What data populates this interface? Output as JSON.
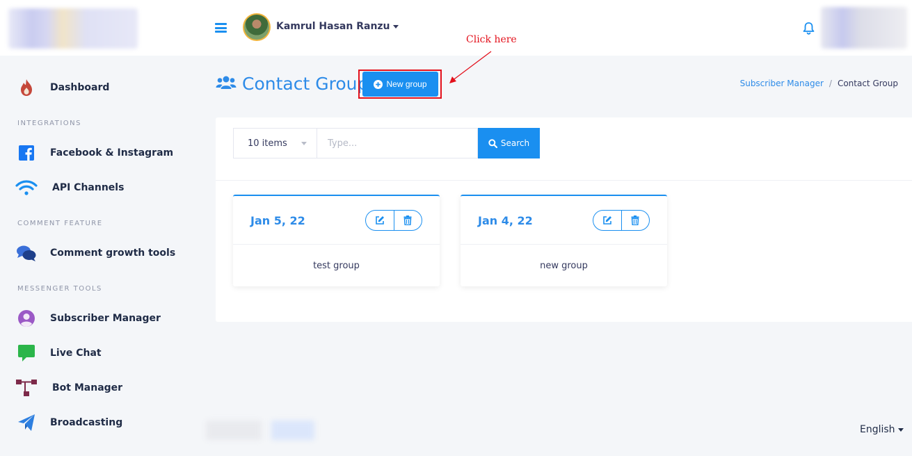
{
  "header": {
    "user_name": "Kamrul Hasan Ranzu"
  },
  "sidebar": {
    "sections": {
      "integrations": "INTEGRATIONS",
      "comment_feature": "COMMENT FEATURE",
      "messenger_tools": "MESSENGER TOOLS"
    },
    "items": [
      {
        "label": "Dashboard",
        "icon": "flame-icon"
      },
      {
        "label": "Facebook & Instagram",
        "icon": "facebook-icon"
      },
      {
        "label": "API Channels",
        "icon": "wifi-icon"
      },
      {
        "label": "Comment growth tools",
        "icon": "comments-icon"
      },
      {
        "label": "Subscriber Manager",
        "icon": "user-circle-icon"
      },
      {
        "label": "Live Chat",
        "icon": "chat-bubble-icon"
      },
      {
        "label": "Bot Manager",
        "icon": "sitemap-icon"
      },
      {
        "label": "Broadcasting",
        "icon": "paper-plane-icon"
      }
    ]
  },
  "page": {
    "title": "Contact Group",
    "new_button_label": "New group",
    "annotation": "Click here",
    "breadcrumb": {
      "parent": "Subscriber Manager",
      "separator": "/",
      "current": "Contact Group"
    }
  },
  "filters": {
    "items_select": "10 items",
    "search_placeholder": "Type...",
    "search_button": "Search"
  },
  "groups": [
    {
      "date": "Jan 5, 22",
      "name": "test group"
    },
    {
      "date": "Jan 4, 22",
      "name": "new group"
    }
  ],
  "footer": {
    "language": "English"
  },
  "colors": {
    "primary": "#1a8ff0",
    "title": "#2d8be8",
    "annotation": "#e3101b"
  }
}
